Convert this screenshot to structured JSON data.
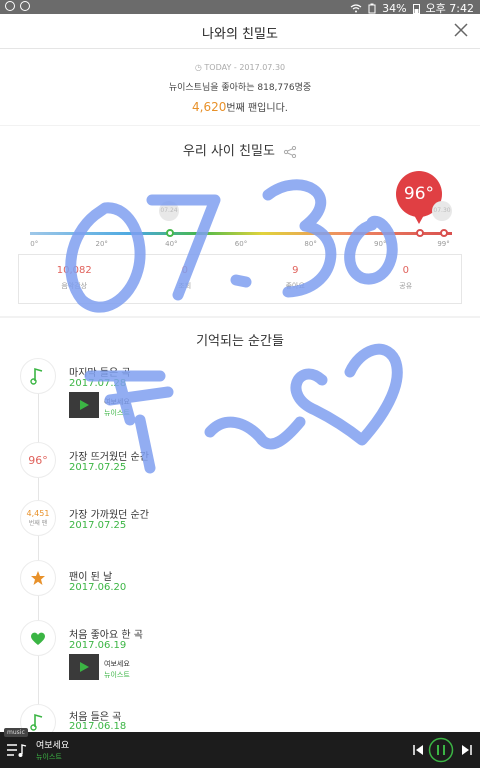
{
  "statusbar": {
    "battery": "34%",
    "time": "오후 7:42"
  },
  "header": {
    "title": "나와의 친밀도"
  },
  "summary": {
    "today_prefix": "TODAY -",
    "today_date": "2017.07.30",
    "fan_line_before": "뉴이스트님을 좋아하는",
    "fan_count": "818,776",
    "fan_line_after": "명중",
    "rank_number": "4,620",
    "rank_text": "번째 팬입니다."
  },
  "gauge": {
    "heading": "우리 사이 친밀도",
    "score": "96°",
    "ticks": [
      "0°",
      "20°",
      "40°",
      "60°",
      "80°",
      "90°",
      "99°"
    ],
    "ghost_markers": [
      "07.30",
      "07.24"
    ],
    "stats": [
      {
        "value": "10,082",
        "label": "음악감상"
      },
      {
        "value": "0",
        "label": "조회"
      },
      {
        "value": "9",
        "label": "좋아요"
      },
      {
        "value": "0",
        "label": "공유"
      }
    ]
  },
  "moments": {
    "heading": "기억되는 순간들",
    "items": [
      {
        "label": "마지막 들은 곡",
        "date": "2017.07.28",
        "song": "여보세요",
        "artist": "뉴이스트"
      },
      {
        "label": "가장 뜨거웠던 순간",
        "date": "2017.07.25",
        "badge": "96°"
      },
      {
        "label": "가장 가까웠던 순간",
        "date": "2017.07.25",
        "badge_num": "4,451",
        "badge_sub": "번째 팬"
      },
      {
        "label": "팬이 된 날",
        "date": "2017.06.20"
      },
      {
        "label": "처음 좋아요 한 곡",
        "date": "2017.06.19",
        "song": "여보세요",
        "artist": "뉴이스트"
      },
      {
        "label": "처음 들은 곡",
        "date": "2017.06.18"
      }
    ]
  },
  "player": {
    "tag": "music",
    "song": "여보세요",
    "artist": "뉴이스트"
  },
  "colors": {
    "accent_green": "#3bb544",
    "orange": "#e8912a",
    "red": "#e03f43",
    "scribble": "#7f9ff0"
  },
  "icons": [
    "wifi-icon",
    "battery-icon",
    "close-icon",
    "share-icon",
    "music-note-icon",
    "star-icon",
    "heart-icon",
    "play-icon",
    "playlist-icon",
    "prev-icon",
    "next-icon",
    "pause-icon"
  ]
}
